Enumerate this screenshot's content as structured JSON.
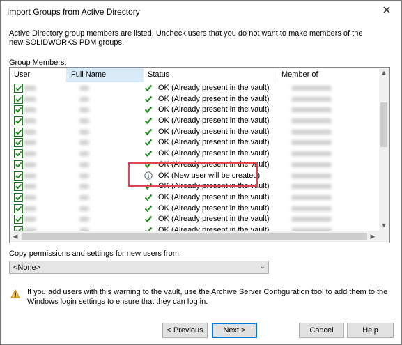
{
  "window": {
    "title": "Import Groups from Active Directory",
    "close_glyph": "✕"
  },
  "intro_text": "Active Directory group members are listed. Uncheck users that you do not want to make members of the new SOLIDWORKS PDM groups.",
  "group_members_label": "Group Members:",
  "columns": [
    "User",
    "Full Name",
    "Status",
    "Member of"
  ],
  "rows": [
    {
      "status": "OK (Already present in the vault)",
      "icon": "check-icon"
    },
    {
      "status": "OK (Already present in the vault)",
      "icon": "check-icon"
    },
    {
      "status": "OK (Already present in the vault)",
      "icon": "check-icon"
    },
    {
      "status": "OK (Already present in the vault)",
      "icon": "check-icon"
    },
    {
      "status": "OK (Already present in the vault)",
      "icon": "check-icon"
    },
    {
      "status": "OK (Already present in the vault)",
      "icon": "check-icon"
    },
    {
      "status": "OK (Already present in the vault)",
      "icon": "check-icon"
    },
    {
      "status": "OK (Already present in the vault)",
      "icon": "check-icon"
    },
    {
      "status": "OK (New user will be created)",
      "icon": "info-icon"
    },
    {
      "status": "OK (Already present in the vault)",
      "icon": "check-icon"
    },
    {
      "status": "OK (Already present in the vault)",
      "icon": "check-icon"
    },
    {
      "status": "OK (Already present in the vault)",
      "icon": "check-icon"
    },
    {
      "status": "OK (Already present in the vault)",
      "icon": "check-icon"
    },
    {
      "status": "OK (Already present in the vault)",
      "icon": "check-icon"
    }
  ],
  "copy_label": "Copy permissions and settings for new users from:",
  "copy_select": {
    "value": "<None>"
  },
  "warning_text": "If you add users with this warning to the vault, use the Archive Server Configuration tool to add them to the Windows login settings to ensure that they can log in.",
  "buttons": {
    "previous": "< Previous",
    "next": "Next >",
    "cancel": "Cancel",
    "help": "Help"
  },
  "colors": {
    "check": "#1e8a1e",
    "highlight": "#e0474c",
    "selected_header": "#d9ebf9",
    "default_button": "#0078d7"
  }
}
